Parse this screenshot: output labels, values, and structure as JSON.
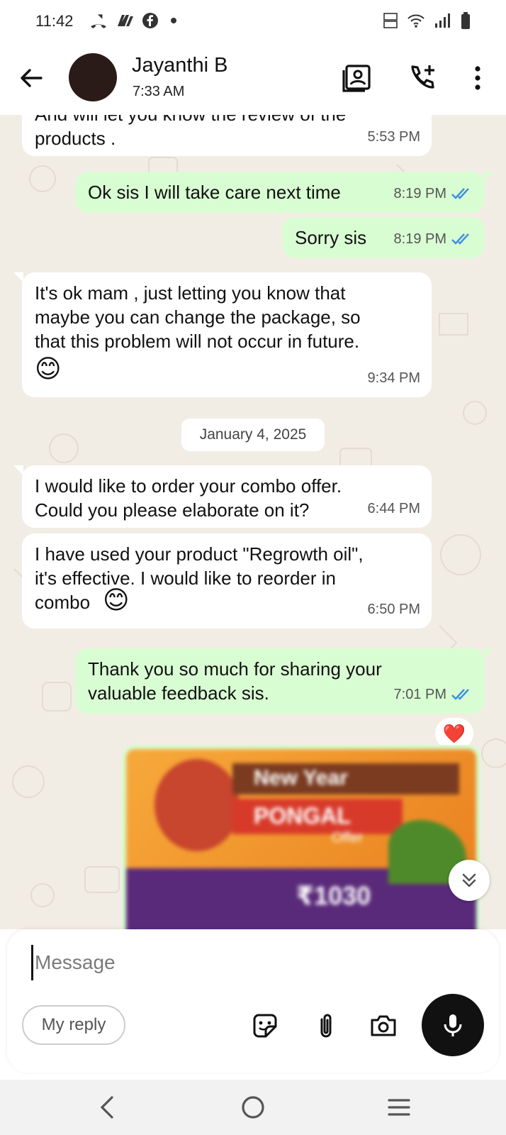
{
  "status_bar": {
    "time": "11:42",
    "left_icons": [
      "missed-call-icon",
      "app-icon",
      "facebook-icon",
      "dot-icon"
    ],
    "right_icons": [
      "volte-icon",
      "wifi-icon",
      "signal-icon",
      "battery-icon"
    ]
  },
  "header": {
    "contact_name": "Jayanthi B",
    "last_seen": "7:33 AM",
    "icons": [
      "back-arrow-icon",
      "contact-card-icon",
      "add-call-icon",
      "more-vert-icon"
    ]
  },
  "messages": [
    {
      "dir": "in",
      "text": "And will let you know the review of the\nproducts .",
      "time": "5:53 PM"
    },
    {
      "dir": "out",
      "text": "Ok sis I will take care next time",
      "time": "8:19 PM",
      "read": true
    },
    {
      "dir": "out",
      "text": "Sorry sis",
      "time": "8:19 PM",
      "read": true
    },
    {
      "dir": "in",
      "text": "It's ok mam , just letting you know that\nmaybe you can change the package, so\nthat this problem will not occur in future.",
      "emoji": "😊",
      "time": "9:34 PM"
    },
    {
      "dir": "in",
      "text": "I would like to order your combo offer.\nCould you please elaborate on it?",
      "time": "6:44 PM"
    },
    {
      "dir": "in",
      "text": "I have used your product \"Regrowth oil\",\nit's effective. I would like to reorder in\ncombo",
      "emoji": "😊",
      "time": "6:50 PM"
    },
    {
      "dir": "out",
      "text": "Thank you so much for sharing your\nvaluable feedback sis.",
      "time": "7:01 PM",
      "read": true,
      "reaction": "❤️"
    }
  ],
  "date_separator": "January 4, 2025",
  "image_message": {
    "line1": "New Year",
    "line2": "PONGAL",
    "line3": "Offer",
    "price": "₹1030"
  },
  "composer": {
    "placeholder": "Message",
    "my_reply": "My reply",
    "icons": [
      "sticker-icon",
      "attach-icon",
      "camera-icon",
      "mic-icon"
    ]
  },
  "navbar": {
    "icons": [
      "nav-back-icon",
      "nav-home-icon",
      "nav-recents-icon"
    ]
  },
  "colors": {
    "incoming_bubble": "#ffffff",
    "outgoing_bubble": "#d9fdd3",
    "chat_background": "#f2ede4",
    "read_tick": "#3b8fe0"
  }
}
